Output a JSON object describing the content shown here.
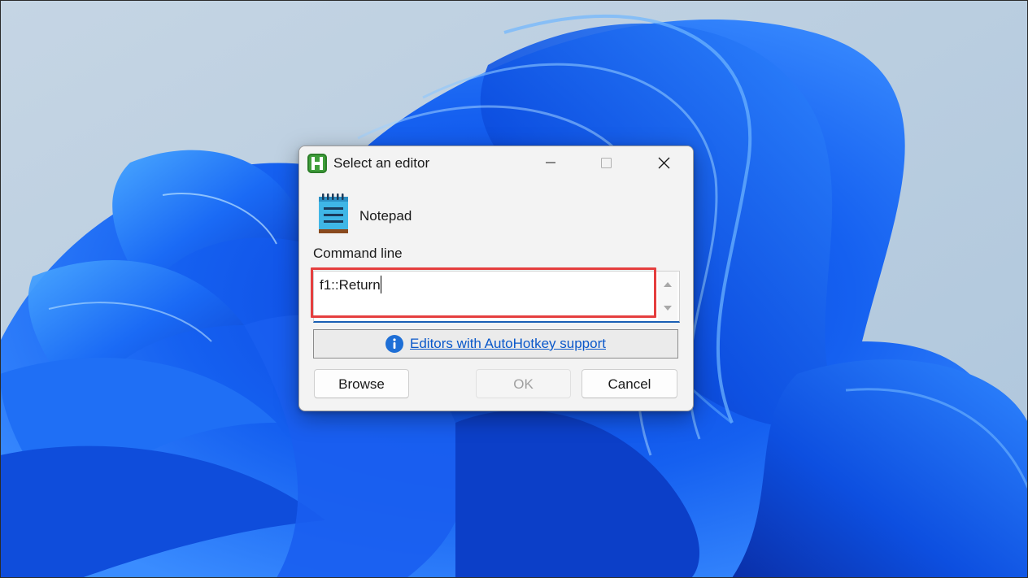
{
  "dialog": {
    "title": "Select an editor",
    "editor_name": "Notepad",
    "command_label": "Command line",
    "command_value": "f1::Return",
    "info_link": "Editors with AutoHotkey support",
    "buttons": {
      "browse": "Browse",
      "ok": "OK",
      "cancel": "Cancel"
    },
    "ok_enabled": false
  },
  "icons": {
    "app": "autohotkey-icon",
    "editor": "notepad-icon",
    "info": "info-icon",
    "minimize": "minimize-icon",
    "maximize": "maximize-icon",
    "close": "close-icon"
  },
  "colors": {
    "highlight": "#e53e3e",
    "link": "#0a58ca",
    "accent": "#1a5fb4",
    "ahk_green": "#3f9e3a"
  }
}
